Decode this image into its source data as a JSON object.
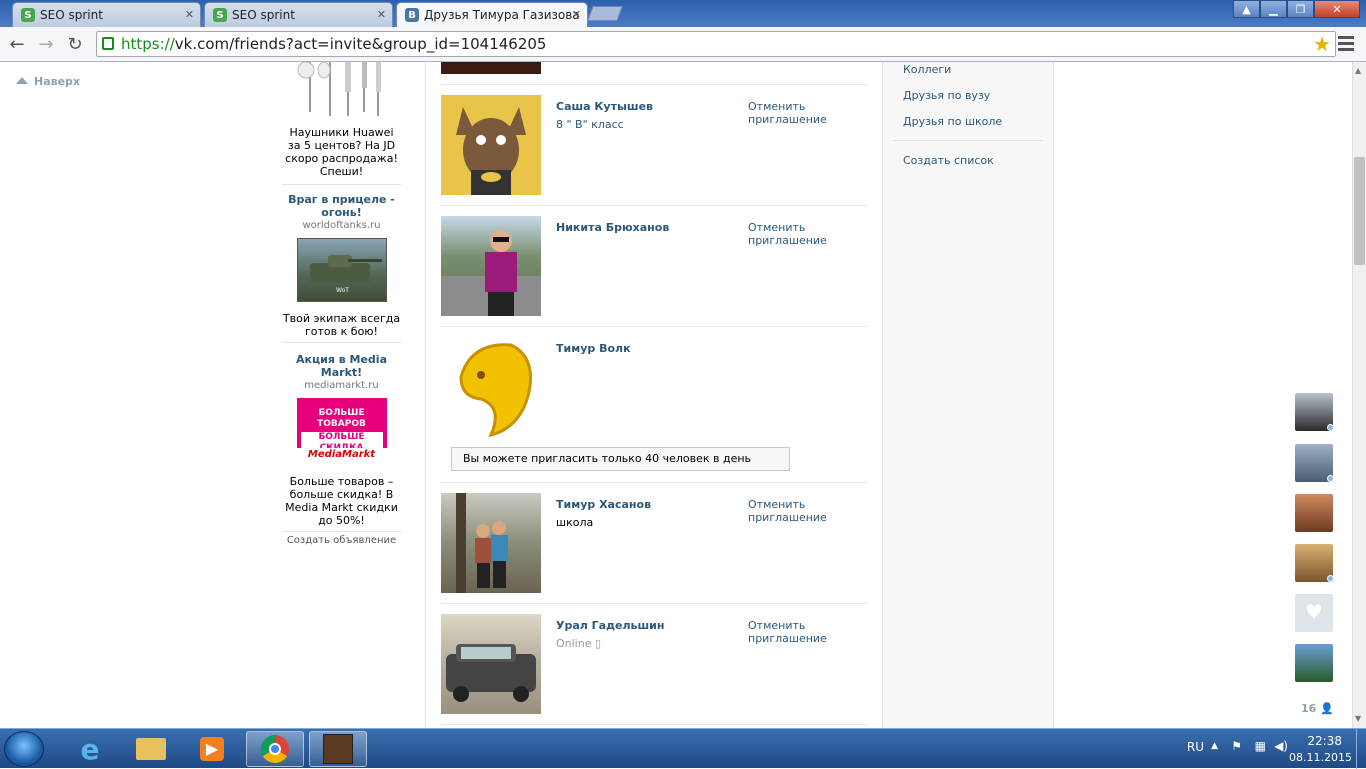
{
  "browser": {
    "tabs": [
      {
        "label": "SEO sprint",
        "favicon": "S"
      },
      {
        "label": "SEO sprint",
        "favicon": "S"
      },
      {
        "label": "Друзья Тимура Газизова",
        "favicon": "B"
      }
    ],
    "url_scheme": "https://",
    "url_rest": "vk.com/friends?act=invite&group_id=104146205"
  },
  "page": {
    "up_label": "Наверх"
  },
  "ads": [
    {
      "title": "",
      "domain": "",
      "text": "Наушники Huawei за 5 центов? На JD скоро распродажа! Спеши!"
    },
    {
      "title": "Враг в прицеле - огонь!",
      "domain": "worldoftanks.ru",
      "text": "Твой экипаж всегда готов к бою!"
    },
    {
      "title": "Акция в Media Markt!",
      "domain": "mediamarkt.ru",
      "text": "Больше товаров – больше скидка! В Media Markt скидки до 50%!",
      "banner_line1": "БОЛЬШЕ ТОВАРОВ",
      "banner_line2": "БОЛЬШЕ СКИДКА",
      "banner_logo": "MediaMarkt"
    },
    {
      "create_label": "Создать объявление"
    }
  ],
  "friends": [
    {
      "name": "Саша Кутышев",
      "sub": "8 \" В\" класс",
      "cancel_line1": "Отменить",
      "cancel_line2": "приглашение"
    },
    {
      "name": "Никита Брюханов",
      "sub": "",
      "cancel_line1": "Отменить",
      "cancel_line2": "приглашение"
    },
    {
      "name": "Тимур Волк",
      "sub": "",
      "notice": "Вы можете пригласить только 40 человек в день"
    },
    {
      "name": "Тимур Хасанов",
      "sub": "школа",
      "cancel_line1": "Отменить",
      "cancel_line2": "приглашение"
    },
    {
      "name": "Урал Гадельшин",
      "sub": "Online",
      "cancel_line1": "Отменить",
      "cancel_line2": "приглашение"
    }
  ],
  "filters": {
    "items": [
      "Коллеги",
      "Друзья по вузу",
      "Друзья по школе"
    ],
    "create_list": "Создать список"
  },
  "online_friends_count": "16",
  "taskbar": {
    "lang": "RU",
    "time": "22:38",
    "date": "08.11.2015"
  },
  "colors": {
    "vk_link": "#2b587a",
    "taskbar": "#1f4a85"
  }
}
